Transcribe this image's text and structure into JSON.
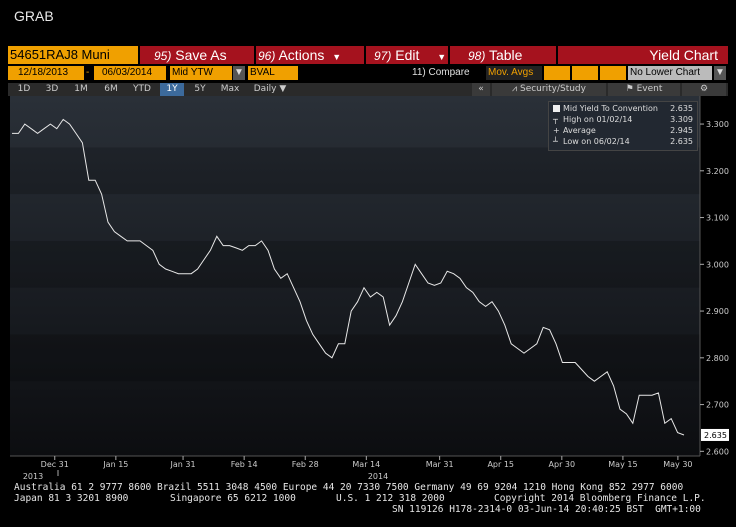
{
  "app_title": "GRAB",
  "toolbar": {
    "ticker": "54651RAJ8 Muni",
    "save": {
      "num": "95)",
      "label": "Save As"
    },
    "actions": {
      "num": "96)",
      "label": "Actions"
    },
    "edit": {
      "num": "97)",
      "label": "Edit"
    },
    "table": {
      "num": "98)",
      "label": "Table"
    },
    "chart_title": "Yield Chart"
  },
  "params": {
    "start_date": "12/18/2013",
    "end_date": "06/03/2014",
    "field": "Mid YTW",
    "source": "BVAL",
    "compare": "11) Compare",
    "mov_avgs": "Mov. Avgs",
    "lower_chart": "No Lower Chart"
  },
  "ranges": [
    "1D",
    "3D",
    "1M",
    "6M",
    "YTD",
    "1Y",
    "5Y",
    "Max"
  ],
  "selected_range": "1Y",
  "periodicity": "Daily",
  "tools": {
    "security_study": "Security/Study",
    "event": "Event"
  },
  "legend": {
    "series": {
      "label": "Mid Yield To Convention",
      "value": "2.635"
    },
    "high": {
      "label": "High on 01/02/14",
      "value": "3.309"
    },
    "avg": {
      "label": "Average",
      "value": "2.945"
    },
    "low": {
      "label": "Low on 06/02/14",
      "value": "2.635"
    }
  },
  "last_value_label": "2.635",
  "chart_data": {
    "type": "line",
    "series": [
      {
        "name": "Mid Yield To Convention",
        "values": [
          3.28,
          3.28,
          3.3,
          3.29,
          3.28,
          3.29,
          3.3,
          3.29,
          3.31,
          3.3,
          3.28,
          3.26,
          3.18,
          3.18,
          3.15,
          3.09,
          3.07,
          3.06,
          3.05,
          3.05,
          3.05,
          3.04,
          3.03,
          3.0,
          2.99,
          2.985,
          2.98,
          2.98,
          2.98,
          2.99,
          3.01,
          3.03,
          3.06,
          3.04,
          3.04,
          3.035,
          3.03,
          3.04,
          3.04,
          3.05,
          3.03,
          2.99,
          2.97,
          2.98,
          2.95,
          2.92,
          2.88,
          2.85,
          2.83,
          2.81,
          2.8,
          2.83,
          2.83,
          2.9,
          2.92,
          2.95,
          2.93,
          2.94,
          2.93,
          2.87,
          2.89,
          2.92,
          2.96,
          3.0,
          2.98,
          2.96,
          2.955,
          2.96,
          2.985,
          2.98,
          2.97,
          2.95,
          2.94,
          2.92,
          2.91,
          2.92,
          2.9,
          2.87,
          2.83,
          2.82,
          2.81,
          2.82,
          2.83,
          2.865,
          2.86,
          2.83,
          2.79,
          2.79,
          2.79,
          2.775,
          2.76,
          2.75,
          2.76,
          2.77,
          2.74,
          2.69,
          2.68,
          2.66,
          2.72,
          2.72,
          2.72,
          2.725,
          2.66,
          2.67,
          2.64,
          2.635
        ]
      }
    ],
    "ylim": [
      2.59,
      3.36
    ],
    "y_ticks": [
      "3.300",
      "3.200",
      "3.100",
      "3.000",
      "2.900",
      "2.800",
      "2.700",
      "2.600"
    ],
    "x_ticks": [
      "Dec 31",
      "Jan 15",
      "Jan 31",
      "Feb 14",
      "Feb 28",
      "Mar 14",
      "Mar 31",
      "Apr 15",
      "Apr 30",
      "May 15",
      "May 30"
    ],
    "year_labels": [
      "2013",
      "2014"
    ],
    "grid": false
  },
  "footer": {
    "line1": "Australia 61 2 9777 8600 Brazil 5511 3048 4500 Europe 44 20 7330 7500 Germany 49 69 9204 1210 Hong Kong 852 2977 6000",
    "line2a": "Japan 81 3 3201 8900",
    "line2b": "Singapore 65 6212 1000",
    "line2c": "U.S. 1 212 318 2000",
    "line2d": "Copyright 2014 Bloomberg Finance L.P.",
    "line3": "SN 119126 H178-2314-0 03-Jun-14 20:40:25 BST  GMT+1:00"
  }
}
